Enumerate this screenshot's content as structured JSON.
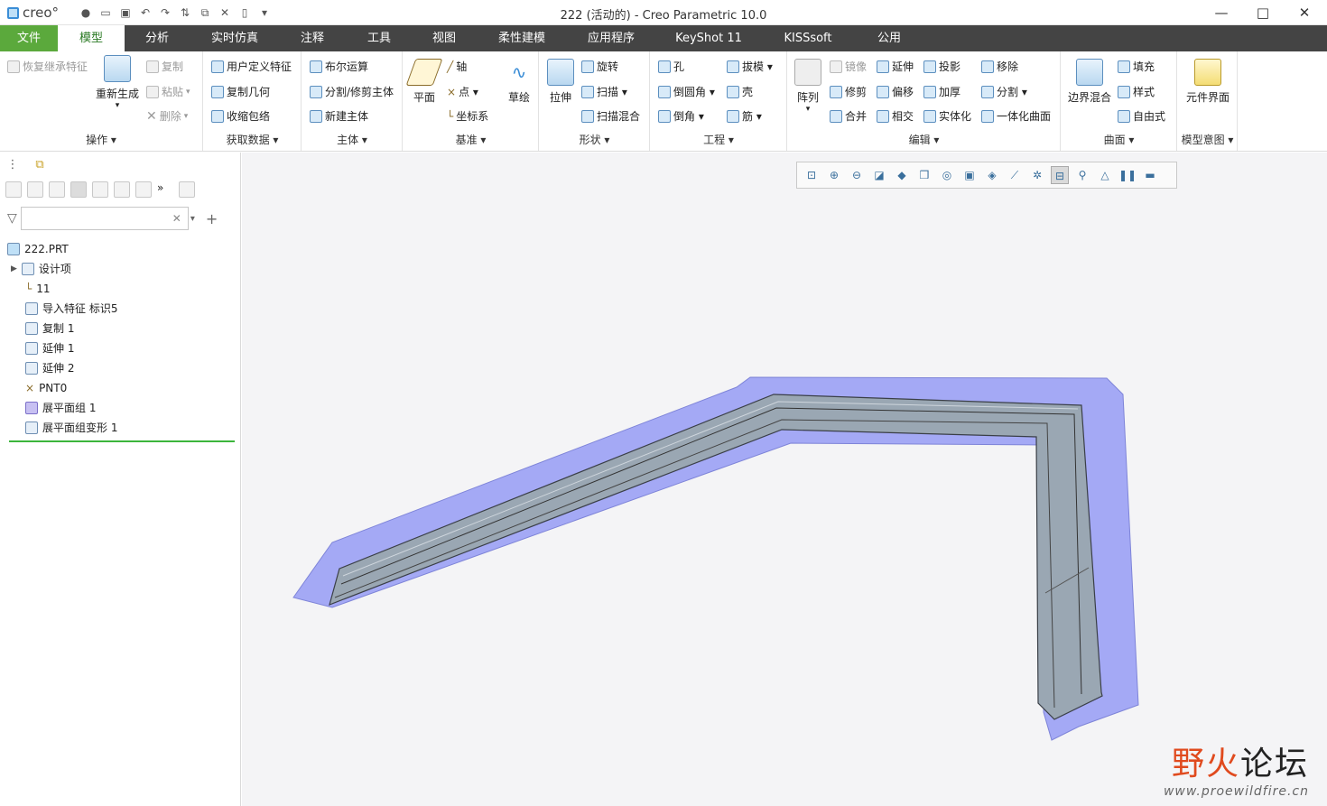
{
  "app": {
    "logo": "creo°",
    "window_title": "222 (活动的) - Creo Parametric 10.0"
  },
  "window_controls": {
    "minimize": "—",
    "maximize": "□",
    "close": "✕"
  },
  "menu": [
    "文件",
    "模型",
    "分析",
    "实时仿真",
    "注释",
    "工具",
    "视图",
    "柔性建模",
    "应用程序",
    "KeyShot 11",
    "KISSsoft",
    "公用"
  ],
  "active_tab": "模型",
  "ribbon": {
    "ops": {
      "label": "操作 ▾",
      "items": [
        "恢复继承特征",
        "重新生成",
        "复制",
        "粘贴",
        "删除"
      ]
    },
    "getdata": {
      "label": "获取数据 ▾",
      "items": [
        "用户定义特征",
        "复制几何",
        "收缩包络"
      ]
    },
    "body": {
      "label": "主体 ▾",
      "items": [
        "布尔运算",
        "分割/修剪主体",
        "新建主体"
      ]
    },
    "datum": {
      "label": "基准 ▾",
      "items": [
        "平面",
        "轴",
        "点 ▾",
        "坐标系",
        "草绘"
      ]
    },
    "shape": {
      "label": "形状 ▾",
      "items": [
        "拉伸",
        "旋转",
        "扫描 ▾",
        "扫描混合"
      ]
    },
    "eng": {
      "label": "工程 ▾",
      "items": [
        "孔",
        "拔模 ▾",
        "倒圆角 ▾",
        "壳",
        "倒角 ▾",
        "筋 ▾"
      ]
    },
    "edit": {
      "label": "编辑 ▾",
      "items": [
        "阵列",
        "镜像",
        "延伸",
        "投影",
        "移除",
        "修剪",
        "偏移",
        "加厚",
        "分割 ▾",
        "合并",
        "相交",
        "实体化",
        "一体化曲面"
      ]
    },
    "surface": {
      "label": "曲面 ▾",
      "items": [
        "边界混合",
        "填充",
        "样式",
        "自由式"
      ]
    },
    "intent": {
      "label": "模型意图 ▾",
      "items": [
        "元件界面"
      ]
    }
  },
  "tree": {
    "filter_placeholder": "",
    "items": [
      "222.PRT",
      "设计项",
      "11",
      "导入特征 标识5",
      "复制 1",
      "延伸 1",
      "延伸 2",
      "PNT0",
      "展平面组 1",
      "展平面组变形 1"
    ]
  },
  "watermark": {
    "main": "野火",
    "main2": "论坛",
    "url": "www.proewildfire.cn"
  },
  "colors": {
    "accent_green": "#5ba93c",
    "menubar": "#444444",
    "surface_blue": "#a4a9f5",
    "part_gray": "#9aa7b3"
  }
}
